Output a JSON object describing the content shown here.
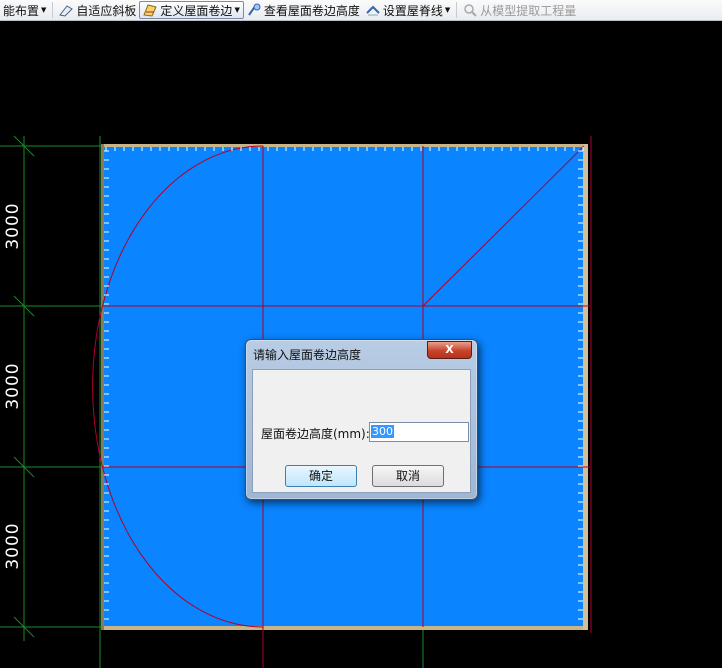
{
  "toolbar": {
    "items": [
      {
        "label": "能布置",
        "icon": "layout-icon",
        "dropdown": true
      },
      {
        "label": "自适应斜板",
        "icon": "slope-slab-icon",
        "dropdown": false
      },
      {
        "label": "定义屋面卷边",
        "icon": "define-upturn-icon",
        "dropdown": true,
        "active": true
      },
      {
        "label": "查看屋面卷边高度",
        "icon": "view-height-icon",
        "dropdown": false
      },
      {
        "label": "设置屋脊线",
        "icon": "ridge-line-icon",
        "dropdown": true
      },
      {
        "label": "从模型提取工程量",
        "icon": "extract-quantity-icon",
        "dropdown": false,
        "disabled": true
      }
    ]
  },
  "canvas": {
    "dimensions": [
      "3000",
      "3000",
      "3000"
    ],
    "colors": {
      "roof_fill": "#0a84ff",
      "grid_red": "#b0002a",
      "grid_green": "#1a8a2a",
      "background": "#000000"
    }
  },
  "dialog": {
    "title": "请输入屋面卷边高度",
    "close_label": "X",
    "field_label": "屋面卷边高度(mm):",
    "field_value": "300",
    "ok_label": "确定",
    "cancel_label": "取消"
  }
}
